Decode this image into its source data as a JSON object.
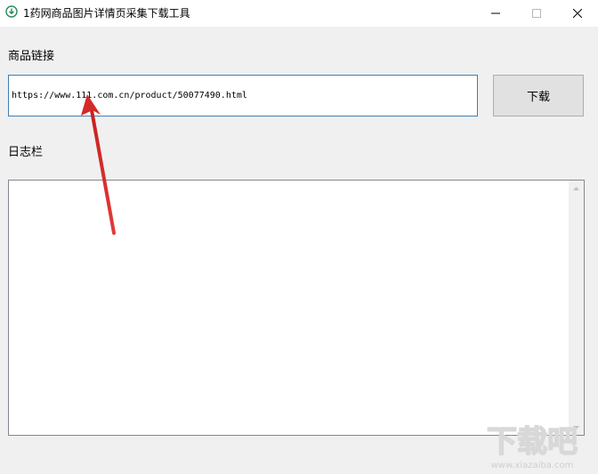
{
  "window": {
    "title": "1药网商品图片详情页采集下载工具"
  },
  "main": {
    "url_label": "商品链接",
    "url_value": "https://www.111.com.cn/product/50077490.html",
    "download_label": "下载",
    "log_label": "日志栏",
    "log_text": ""
  },
  "watermark": {
    "text_main": "下载吧",
    "text_url": "www.xiazaiba.com"
  },
  "colors": {
    "input_border": "#3c7fb1",
    "arrow": "#d42a2a"
  },
  "icons": [
    "download-icon",
    "minimize-icon",
    "maximize-icon",
    "close-icon",
    "scroll-up-icon",
    "scroll-down-icon"
  ]
}
